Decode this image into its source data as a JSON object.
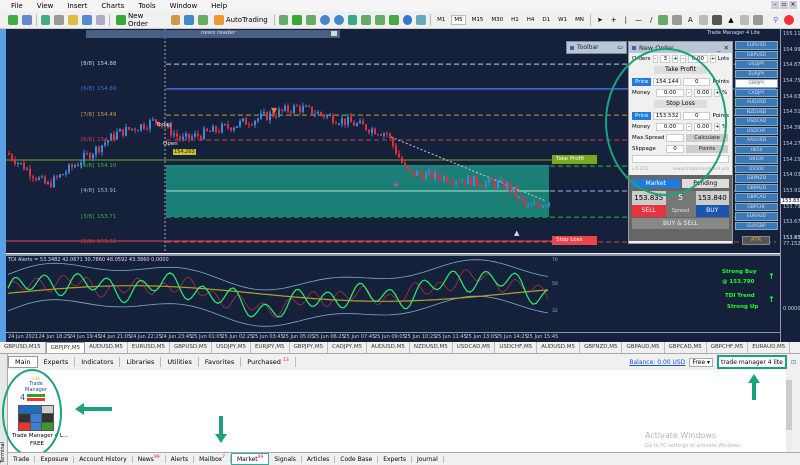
{
  "menu": [
    "File",
    "View",
    "Insert",
    "Charts",
    "Tools",
    "Window",
    "Help"
  ],
  "toolbar": {
    "new_order": "New Order",
    "autotrading": "AutoTrading",
    "timeframes": [
      "M1",
      "M5",
      "M15",
      "M30",
      "H1",
      "H4",
      "D1",
      "W1",
      "MN"
    ]
  },
  "chart": {
    "title": "Trade Manager 4 Lite",
    "news_reader": "news reader",
    "today_label": "Today",
    "open_label": "Open",
    "open_price": "154.203",
    "murray": [
      {
        "label": "[8/8]",
        "value": "154.88",
        "color": "#c8d0dc"
      },
      {
        "label": "[6/8]",
        "value": "154.69",
        "color": "#3f6fe0"
      },
      {
        "label": "[7/8]",
        "value": "154.49",
        "color": "#c9a03c"
      },
      {
        "label": "[6/8]",
        "value": "154.30",
        "color": "#d63a3a"
      },
      {
        "label": "[5/8]",
        "value": "154.10",
        "color": "#2bbf3a"
      },
      {
        "label": "[4/8]",
        "value": "153.91",
        "color": "#9ab4e0"
      },
      {
        "label": "[3/8]",
        "value": "153.71",
        "color": "#2bbf3a"
      },
      {
        "label": "[2/8]",
        "value": "153.52",
        "color": "#d63a3a"
      }
    ],
    "take_profit": "Take Profit",
    "stop_loss": "Stop Loss",
    "price_axis": [
      "155.110",
      "154.990",
      "154.870",
      "154.750",
      "154.630",
      "154.510",
      "154.390",
      "154.270",
      "154.150",
      "154.030",
      "153.910",
      "153.790",
      "153.670",
      "153.550"
    ],
    "current_price": "153.835",
    "indicator": {
      "label": "TDI Alerts = 53.3482 42.0671 30.7860 48.0592 43.3860 0.0000",
      "levels": [
        "70",
        "50",
        "32"
      ],
      "axis": [
        "153.430",
        "77.1527",
        "0.0000"
      ]
    },
    "signals": {
      "strong_buy": "Strong Buy",
      "at_price": "@ 153.790",
      "tdi_trend": "TDI Trend",
      "strong_up": "Strong Up"
    },
    "time_axis": [
      "24 Jun 2021",
      "24 Jun 18:25",
      "24 Jun 19:45",
      "24 Jun 21:05",
      "24 Jun 22:25",
      "24 Jun 23:45",
      "25 Jun 01:05",
      "25 Jun 02:25",
      "25 Jun 03:45",
      "25 Jun 05:05",
      "25 Jun 06:25",
      "25 Jun 07:45",
      "25 Jun 09:05",
      "25 Jun 10:25",
      "25 Jun 11:45",
      "25 Jun 13:05",
      "25 Jun 14:25",
      "25 Jun 15:45"
    ]
  },
  "toolbar_window": "Toolbar",
  "order_panel": {
    "title": "New Order",
    "orders_label": "Orders",
    "orders": "3",
    "lots": "0.00",
    "lots_label": "Lots",
    "tp_header": "Take Profit",
    "price_btn": "Price",
    "tp_price": "154.144",
    "tp_points": "0",
    "points_label": "Points",
    "money_label": "Money",
    "tp_money": "0.00",
    "tp_pct": "0.00",
    "pct": "%",
    "sl_header": "Stop Loss",
    "sl_price": "153.532",
    "sl_points": "0",
    "sl_money": "0.00",
    "sl_pct": "0.00",
    "max_spread": "Max.Spread",
    "calculate": "Calculate",
    "slippage": "Slippage",
    "slippage_val": "0",
    "points_btn": "Points",
    "version": "v.5.212",
    "site": "www.trademanager4.pro",
    "market": "Market",
    "pending": "Pending",
    "bid": "153.835",
    "ask": "153.840",
    "spread": "5",
    "spread_label": "Spread",
    "sell": "SELL",
    "buy": "BUY",
    "buy_sell": "BUY & SELL"
  },
  "symbols": [
    "EURUSD",
    "GBPUSD",
    "USDJPY",
    "EURJPY",
    "GBPJPY",
    "CADJPY",
    "AUDUSD",
    "NZDUSD",
    "USDCAD",
    "USDCHF",
    "XAUUSD",
    "HK50",
    "UK100",
    "US500",
    "GBPNZD",
    "GBPAUD",
    "GBPCAD",
    "GBPCHF",
    "EURAUD",
    "EURGBP"
  ],
  "selected_symbol": "GBPJPY",
  "atr": "ATR",
  "chart_tabs": [
    "GBPUSD,M15",
    "GBPJPY,M5",
    "AUDUSD,M5",
    "EURUSD,M5",
    "GBPUSD,M5",
    "USDJPY,M5",
    "EURJPY,M5",
    "GBPJPY,M5",
    "CADJPY,M5",
    "AUDUSD,M5",
    "NZDUSD,M5",
    "USDCAD,M5",
    "USDCHF,M5",
    "AUDUSD,M5",
    "GBPNZD,M5",
    "GBPAUD,M5",
    "GBPCAD,M5",
    "GBPCHF,M5",
    "EURAUD,M5"
  ],
  "market_tabs": {
    "items": [
      "Main",
      "Experts",
      "Indicators",
      "Libraries",
      "Utilities",
      "Favorites",
      "Purchased"
    ],
    "purchased_count": "13",
    "balance": "Balance: 0.00 USD",
    "filter": "Free",
    "search": "trade manager 4 lite"
  },
  "product": {
    "lite": "Lite",
    "name_logo": "Trade Manager",
    "num": "4",
    "title": "Trade Manager 4 L...",
    "price": "FREE"
  },
  "watermark": {
    "title": "Activate Windows",
    "sub": "Go to PC settings to activate Windows."
  },
  "terminal_label": "Terminal",
  "bottom_tabs": [
    {
      "label": "Trade"
    },
    {
      "label": "Exposure"
    },
    {
      "label": "Account History"
    },
    {
      "label": "News",
      "badge": "99"
    },
    {
      "label": "Alerts"
    },
    {
      "label": "Mailbox",
      "badge": "7"
    },
    {
      "label": "Market",
      "badge": "99"
    },
    {
      "label": "Signals"
    },
    {
      "label": "Articles"
    },
    {
      "label": "Code Base"
    },
    {
      "label": "Experts"
    },
    {
      "label": "Journal"
    }
  ],
  "colors": {
    "chart_bg": "#15213a",
    "bull": "#3d8bdf",
    "bear": "#e0303a",
    "accent": "#1aa37a"
  }
}
